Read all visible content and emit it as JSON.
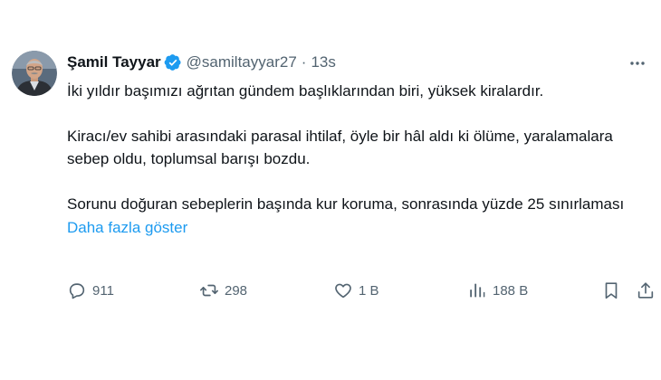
{
  "author": {
    "name": "Şamil Tayyar",
    "handle": "@samiltayyar27",
    "separator": "·",
    "time": "13s"
  },
  "tweet": {
    "paragraphs": [
      "İki yıldır başımızı ağrıtan gündem başlıklarından biri, yüksek kiralardır.",
      "Kiracı/ev sahibi arasındaki parasal ihtilaf, öyle bir hâl aldı ki ölüme, yaralamalara sebep oldu, toplumsal barışı bozdu.",
      "Sorunu doğuran sebeplerin başında kur koruma, sonrasında yüzde 25 sınırlaması"
    ],
    "show_more": "Daha fazla göster"
  },
  "actions": {
    "replies": "911",
    "reposts": "298",
    "likes": "1 B",
    "views": "188 B"
  },
  "colors": {
    "text": "#0f1419",
    "secondary": "#536471",
    "link": "#1d9bf0",
    "verified": "#1d9bf0"
  },
  "icons": [
    "avatar",
    "verified-badge-icon",
    "more-options-icon",
    "reply-icon",
    "repost-icon",
    "like-icon",
    "views-icon",
    "bookmark-icon",
    "share-icon"
  ]
}
